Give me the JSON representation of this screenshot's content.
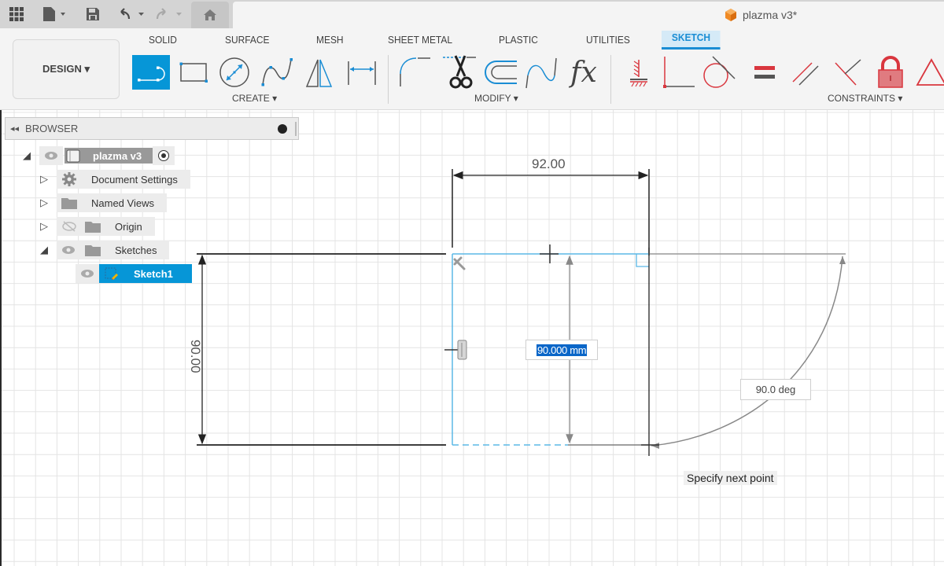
{
  "toolbar": {
    "apps_icon": "grid-icon",
    "file_icon": "file-icon",
    "save_icon": "save-icon",
    "undo_icon": "undo-icon",
    "redo_icon": "redo-icon",
    "home_icon": "home-icon"
  },
  "document": {
    "title": "plazma v3*"
  },
  "workspace": {
    "label": "DESIGN ▾"
  },
  "tabs": [
    {
      "label": "SOLID"
    },
    {
      "label": "SURFACE"
    },
    {
      "label": "MESH"
    },
    {
      "label": "SHEET METAL"
    },
    {
      "label": "PLASTIC"
    },
    {
      "label": "UTILITIES"
    },
    {
      "label": "SKETCH",
      "active": true
    }
  ],
  "groups": {
    "create": {
      "label": "CREATE ▾",
      "tools": [
        "line",
        "rectangle",
        "circle",
        "spline",
        "mirror",
        "sketch-dimension"
      ]
    },
    "modify": {
      "label": "MODIFY ▾",
      "tools": [
        "fillet",
        "trim",
        "offset",
        "conic-curve",
        "change-parameters"
      ]
    },
    "constraints": {
      "label": "CONSTRAINTS ▾",
      "tools": [
        "fix",
        "coincident-perpendicular",
        "tangent",
        "equal",
        "parallel",
        "perpendicular",
        "lock",
        "triangle"
      ]
    }
  },
  "browser": {
    "title": "BROWSER",
    "items": [
      {
        "label": "plazma v3",
        "level": 0,
        "expanded": true
      },
      {
        "label": "Document Settings",
        "level": 1
      },
      {
        "label": "Named Views",
        "level": 1
      },
      {
        "label": "Origin",
        "level": 1,
        "hidden": true
      },
      {
        "label": "Sketches",
        "level": 1,
        "expanded": true
      },
      {
        "label": "Sketch1",
        "level": 2,
        "selected": true
      }
    ]
  },
  "sketch": {
    "dim_width": "92.00",
    "dim_height": "90.00",
    "input_value": "90.000 mm",
    "angle_value": "90.0 deg",
    "hint": "Specify next point"
  },
  "colors": {
    "accent": "#0696d7",
    "sketch_line": "#5bb8e6",
    "constraint_red": "#d9363e"
  }
}
